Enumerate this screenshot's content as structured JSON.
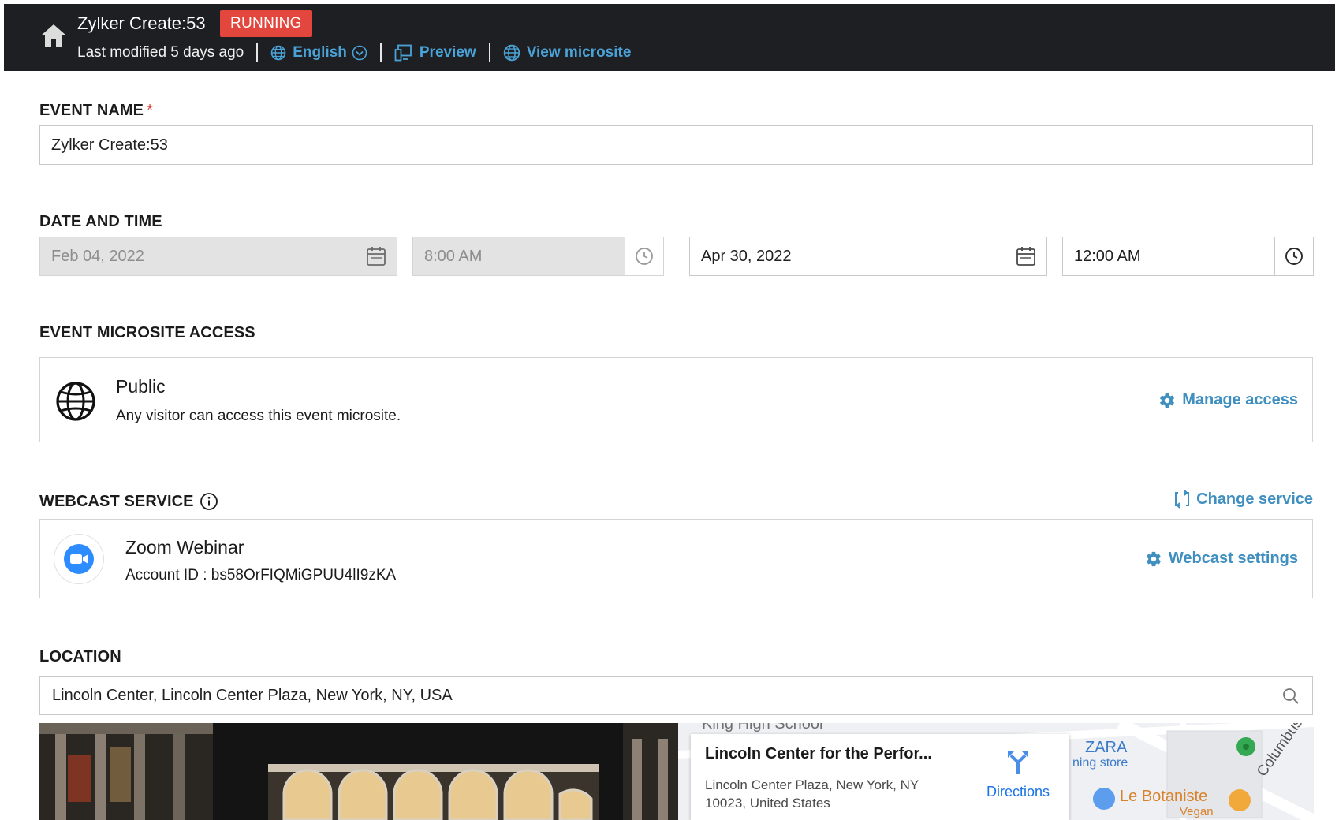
{
  "header": {
    "event_title": "Zylker Create:53",
    "status": "RUNNING",
    "last_modified": "Last modified 5 days ago",
    "language": "English",
    "preview": "Preview",
    "view_microsite": "View microsite",
    "background_color": "#1e1f22",
    "status_color": "#e2463c",
    "link_color": "#4aa3d8"
  },
  "event_name": {
    "label": "EVENT NAME",
    "required_marker": "*",
    "value": "Zylker Create:53"
  },
  "date_time": {
    "label": "DATE AND TIME",
    "start_date": "Feb 04, 2022",
    "start_time": "8:00 AM",
    "end_date": "Apr 30, 2022",
    "end_time": "12:00 AM"
  },
  "microsite_access": {
    "label": "EVENT MICROSITE ACCESS",
    "title": "Public",
    "description": "Any visitor can access this event microsite.",
    "action": "Manage access"
  },
  "webcast": {
    "label": "WEBCAST SERVICE",
    "change_service": "Change service",
    "service_name": "Zoom Webinar",
    "account": "Account ID : bs58OrFIQMiGPUU4lI9zKA",
    "action": "Webcast settings"
  },
  "location": {
    "label": "LOCATION",
    "value": "Lincoln Center, Lincoln Center Plaza, New York, NY, USA",
    "map": {
      "place_name": "Lincoln Center for the Perfor...",
      "address_line1": "Lincoln Center Plaza, New York, NY",
      "address_line2": "10023, United States",
      "directions": "Directions",
      "label_school": "King High School",
      "label_zara": "ZARA",
      "label_clothing": "ning store",
      "label_botaniste": "Le Botaniste",
      "label_vegan": "Vegan",
      "label_street": "Columbus Av"
    }
  },
  "icons": {
    "home": "home-icon",
    "globe": "globe-icon",
    "preview": "preview-icon",
    "calendar": "calendar-icon",
    "clock": "clock-icon",
    "gear": "gear-icon",
    "info": "info-icon",
    "refresh": "change-service-icon",
    "zoom": "zoom-camera-icon",
    "search": "search-icon",
    "directions": "directions-icon"
  }
}
